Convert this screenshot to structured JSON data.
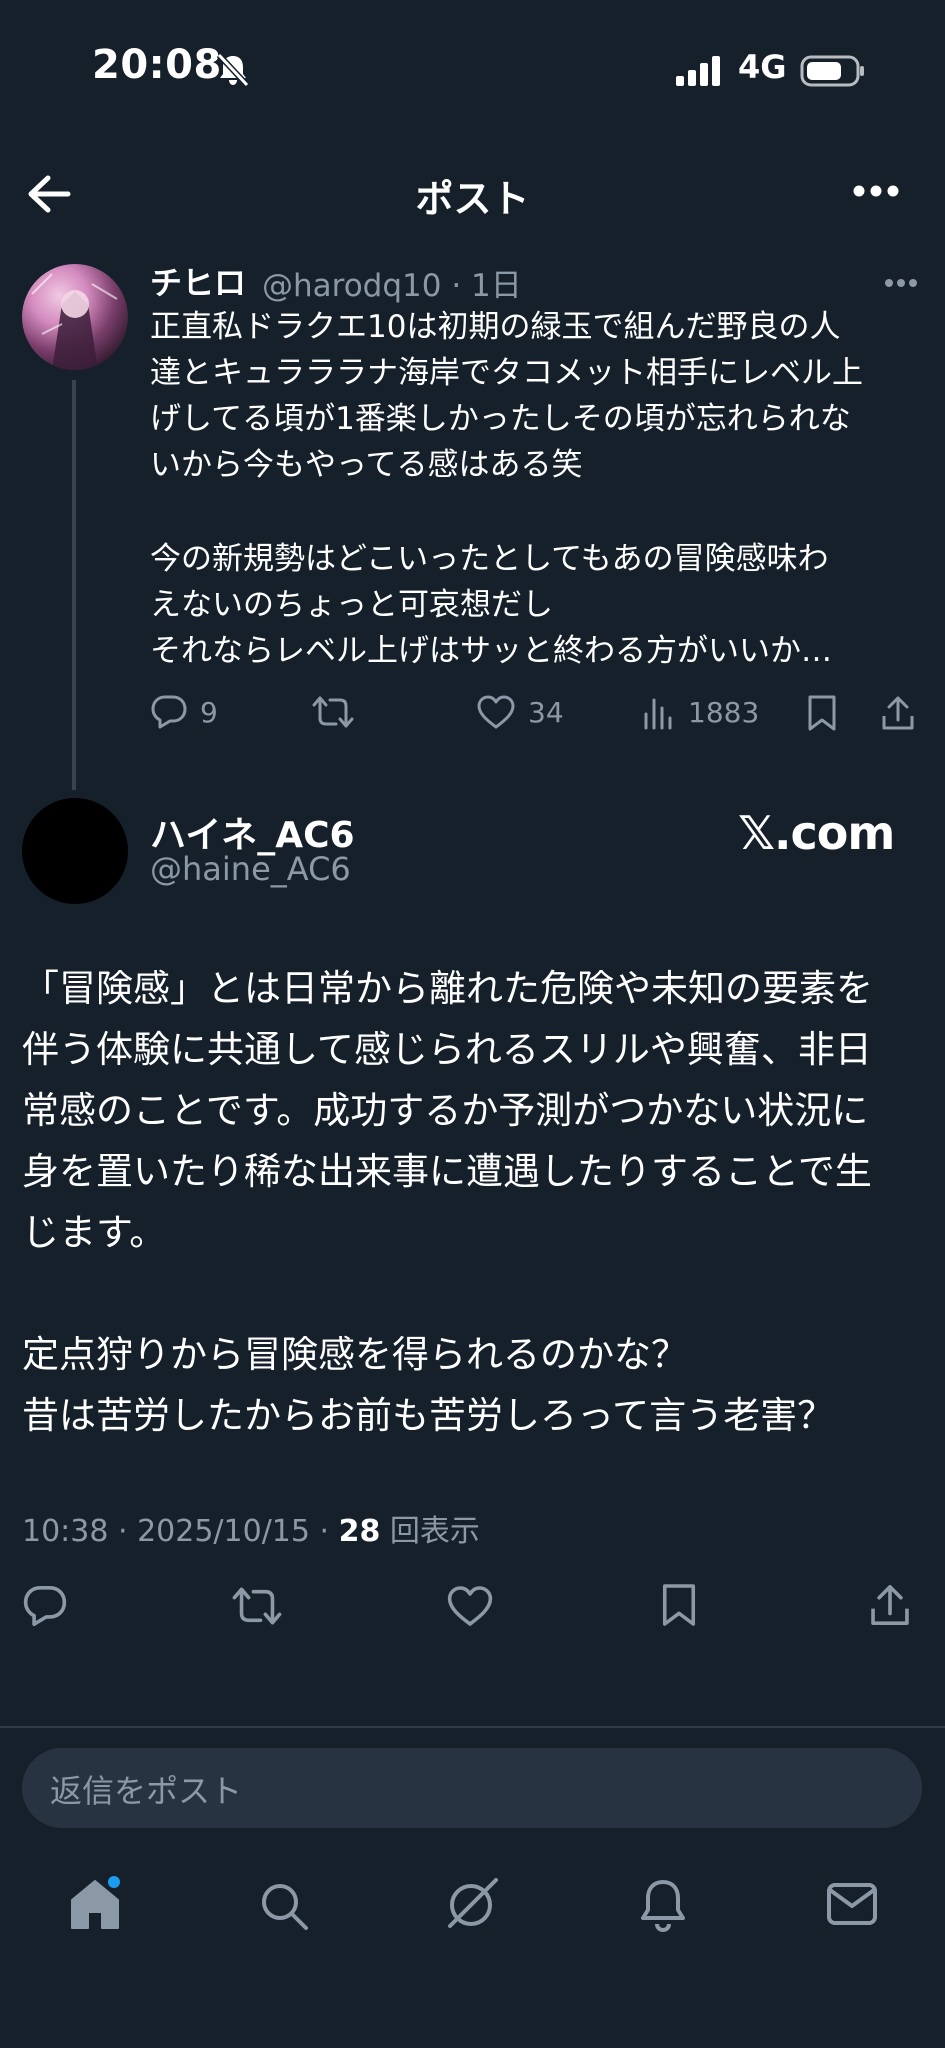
{
  "status_bar": {
    "time": "20:08",
    "network": "4G"
  },
  "header": {
    "title": "ポスト"
  },
  "parent_post": {
    "name": "チヒロ",
    "meta": "@harodq10 · 1日",
    "lines": [
      "正直私ドラクエ10は初期の緑玉で組んだ野良の人",
      "達とキュラララナ海岸でタコメット相手にレベル上",
      "げしてる頃が1番楽しかったしその頃が忘れられな",
      "いから今もやってる感はある笑",
      "今の新規勢はどこいったとしてもあの冒険感味わ",
      "えないのちょっと可哀想だし",
      "それならレベル上げはサッと終わる方がいいか…"
    ],
    "actions": {
      "replies": "9",
      "likes": "34",
      "views": "1883"
    }
  },
  "main_post": {
    "name": "ハイネ_AC6",
    "handle": "@haine_AC6",
    "brand": "𝕏.com",
    "lines": [
      "「冒険感」とは日常から離れた危険や未知の要素を",
      "伴う体験に共通して感じられるスリルや興奮、非日",
      "常感のことです。成功するか予測がつかない状況に",
      "身を置いたり稀な出来事に遭遇したりすることで生",
      "じます。",
      "定点狩りから冒険感を得られるのかな？",
      "昔は苦労したからお前も苦労しろって言う老害？"
    ],
    "timestamp": "10:38 · 2025/10/15 · ",
    "view_count": "28",
    "view_label": "回表示"
  },
  "reply": {
    "placeholder": "返信をポスト"
  },
  "colors": {
    "background": "#15202b",
    "muted": "#8b98a5",
    "accent": "#1d9bf0",
    "divider": "#2f3b45"
  },
  "icons": [
    "bell-slash-icon",
    "signal-icon",
    "battery-icon",
    "back-arrow-icon",
    "more-icon",
    "reply-icon",
    "repost-icon",
    "like-icon",
    "views-icon",
    "bookmark-icon",
    "share-icon",
    "home-icon",
    "search-icon",
    "grok-icon",
    "notifications-icon",
    "messages-icon"
  ]
}
